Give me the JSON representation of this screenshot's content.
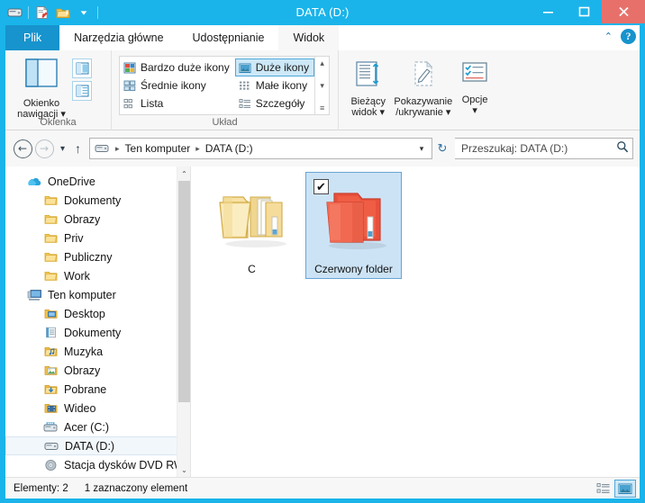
{
  "window": {
    "title": "DATA (D:)",
    "accent_color": "#1ab4ea",
    "close_color": "#e8706b",
    "selection_color": "#cce3f5"
  },
  "quick_access": {
    "items": [
      {
        "name": "drive-icon",
        "label": "DATA (D:)"
      },
      {
        "name": "properties-icon",
        "label": "Właściwości"
      },
      {
        "name": "new-folder-icon",
        "label": "Nowy folder"
      },
      {
        "name": "customize-dropdown-icon",
        "label": "Dostosuj pasek narzędzi Szybki dostęp"
      }
    ]
  },
  "window_controls": {
    "minimize": "Minimalizuj",
    "maximize": "Maksymalizuj",
    "close": "Zamknij",
    "minimize_glyph": "–",
    "maximize_glyph": "▭",
    "close_glyph": "✕"
  },
  "ribbon": {
    "tabs": [
      {
        "label": "Plik",
        "active": false,
        "kind": "file"
      },
      {
        "label": "Narzędzia główne",
        "active": false,
        "kind": "normal"
      },
      {
        "label": "Udostępnianie",
        "active": false,
        "kind": "normal"
      },
      {
        "label": "Widok",
        "active": true,
        "kind": "normal"
      }
    ],
    "collapse_label": "Zwiń Wstążkę",
    "collapse_glyph": "⌃",
    "help_label": "Pomoc",
    "help_glyph": "?",
    "groups": [
      {
        "label": "Okienka",
        "big_button": {
          "label_line1": "Okienko",
          "label_line2": "nawigacji",
          "icon": "navigation-pane-icon",
          "has_dropdown": true
        },
        "small_buttons": [
          {
            "name": "preview-pane-icon",
            "label": "Okienko podglądu"
          },
          {
            "name": "details-pane-icon",
            "label": "Okienko szczegółów"
          }
        ]
      },
      {
        "label": "Układ",
        "gallery": {
          "column_left": [
            {
              "label": "Bardzo duże ikony",
              "icon": "extra-large-icons-icon",
              "selected": false
            },
            {
              "label": "Średnie ikony",
              "icon": "medium-icons-icon",
              "selected": false
            },
            {
              "label": "Lista",
              "icon": "list-icon",
              "selected": false
            }
          ],
          "column_right": [
            {
              "label": "Duże ikony",
              "icon": "large-icons-icon",
              "selected": true
            },
            {
              "label": "Małe ikony",
              "icon": "small-icons-icon",
              "selected": false
            },
            {
              "label": "Szczegóły",
              "icon": "details-icon",
              "selected": false
            }
          ],
          "scroll_up_glyph": "▴",
          "scroll_down_glyph": "▾",
          "scroll_more_glyph": "≡"
        }
      },
      {
        "label": "",
        "buttons": [
          {
            "label_line1": "Bieżący",
            "label_line2": "widok",
            "icon": "current-view-icon",
            "has_dropdown": true
          },
          {
            "label_line1": "Pokazywanie",
            "label_line2": "/ukrywanie",
            "icon": "show-hide-icon",
            "has_dropdown": true
          },
          {
            "label_line1": "Opcje",
            "label_line2": "",
            "icon": "options-icon",
            "has_dropdown": true
          }
        ]
      }
    ]
  },
  "address_bar": {
    "back_label": "Wstecz",
    "back_glyph": "←",
    "forward_label": "Dalej",
    "forward_glyph": "→",
    "recent_label": "Ostatnie lokalizacje",
    "recent_glyph": "▾",
    "up_label": "W górę",
    "up_glyph": "↑",
    "path_icon": "drive-icon",
    "breadcrumbs": [
      "Ten komputer",
      "DATA (D:)"
    ],
    "separator_glyph": "▸",
    "dropdown_glyph": "▾",
    "refresh_label": "Odśwież",
    "refresh_glyph": "↻",
    "search_placeholder": "Przeszukaj: DATA (D:)",
    "search_value": "",
    "search_icon": "search-icon"
  },
  "navigation_pane": {
    "tree": [
      {
        "label": "OneDrive",
        "icon": "onedrive-icon",
        "level": 0,
        "selected": false
      },
      {
        "label": "Dokumenty",
        "icon": "folder-icon",
        "level": 1,
        "selected": false
      },
      {
        "label": "Obrazy",
        "icon": "folder-icon",
        "level": 1,
        "selected": false
      },
      {
        "label": "Priv",
        "icon": "folder-icon",
        "level": 1,
        "selected": false
      },
      {
        "label": "Publiczny",
        "icon": "folder-icon",
        "level": 1,
        "selected": false
      },
      {
        "label": "Work",
        "icon": "folder-icon",
        "level": 1,
        "selected": false
      },
      {
        "label": "Ten komputer",
        "icon": "this-pc-icon",
        "level": 0,
        "selected": false
      },
      {
        "label": "Desktop",
        "icon": "desktop-icon",
        "level": 1,
        "selected": false
      },
      {
        "label": "Dokumenty",
        "icon": "documents-icon",
        "level": 1,
        "selected": false
      },
      {
        "label": "Muzyka",
        "icon": "music-icon",
        "level": 1,
        "selected": false
      },
      {
        "label": "Obrazy",
        "icon": "pictures-icon",
        "level": 1,
        "selected": false
      },
      {
        "label": "Pobrane",
        "icon": "downloads-icon",
        "level": 1,
        "selected": false
      },
      {
        "label": "Wideo",
        "icon": "videos-icon",
        "level": 1,
        "selected": false
      },
      {
        "label": "Acer (C:)",
        "icon": "system-drive-icon",
        "level": 1,
        "selected": false
      },
      {
        "label": "DATA (D:)",
        "icon": "drive-icon",
        "level": 1,
        "selected": true
      },
      {
        "label": "Stacja dysków DVD RW (F:",
        "icon": "dvd-drive-icon",
        "level": 1,
        "selected": false
      }
    ],
    "scrollbar": {
      "up_glyph": "⌃",
      "down_glyph": "⌄"
    }
  },
  "file_pane": {
    "items": [
      {
        "name": "C",
        "icon": "multi-folder-icon",
        "selected": false,
        "checked": false
      },
      {
        "name": "Czerwony folder",
        "icon": "red-folder-icon",
        "selected": true,
        "checked": true
      }
    ],
    "check_glyph": "✔"
  },
  "status_bar": {
    "item_count_text": "Elementy: 2",
    "selection_text": "1 zaznaczony element",
    "view_buttons": [
      {
        "name": "details-view-button",
        "label": "Szczegóły",
        "active": false
      },
      {
        "name": "large-icons-view-button",
        "label": "Duże ikony",
        "active": true
      }
    ]
  }
}
